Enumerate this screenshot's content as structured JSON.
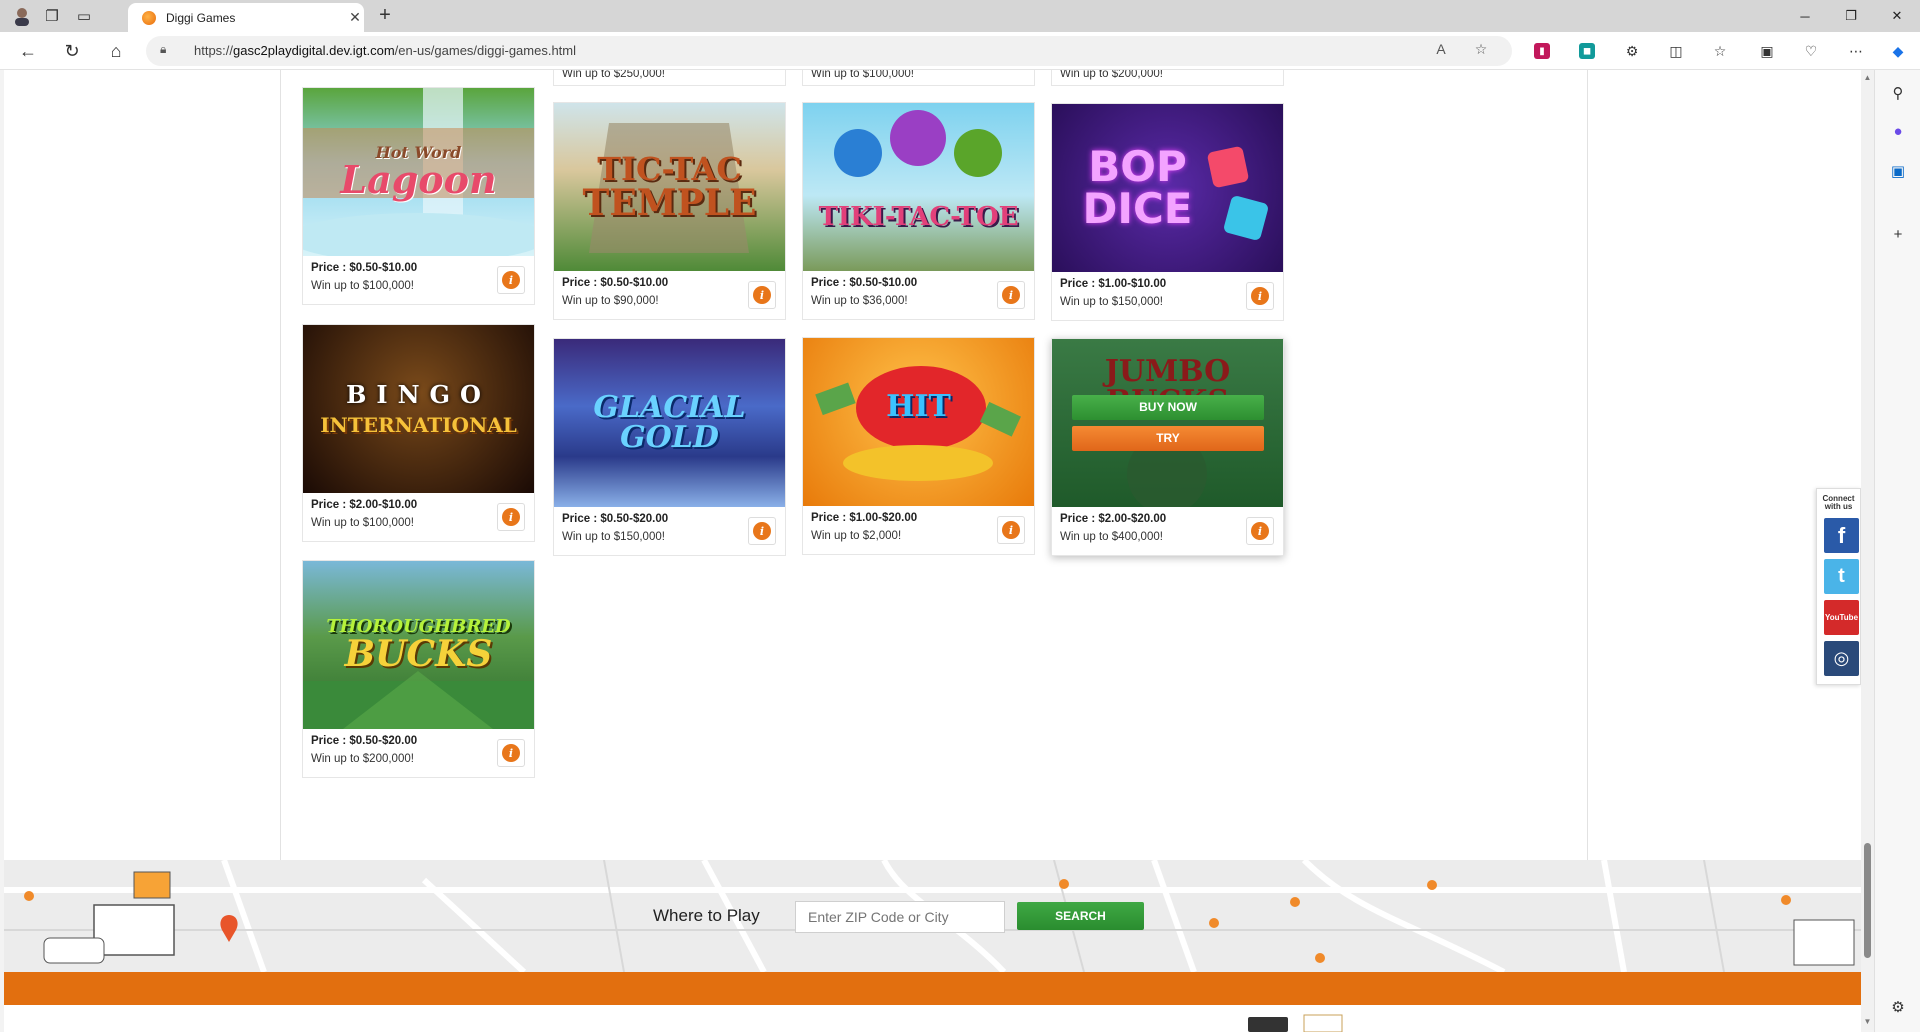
{
  "browser": {
    "tab_title": "Diggi Games",
    "url_prefix": "https://",
    "url_host": "gasc2playdigital.dev.igt.com",
    "url_path": "/en-us/games/diggi-games.html"
  },
  "top_partial_row": [
    {
      "win": "Win up to $250,000!"
    },
    {
      "win": "Win up to $100,000!"
    },
    {
      "win": "Win up to $200,000!"
    }
  ],
  "games": [
    {
      "name": "Hot Word Lagoon",
      "art_line1": "Hot Word",
      "art_line2": "Lagoon",
      "price": "Price : $0.50-$10.00",
      "win": "Win up to $100,000!"
    },
    {
      "name": "Tic-Tac Temple",
      "art_line1": "TIC-TAC",
      "art_line2": "TEMPLE",
      "price": "Price : $0.50-$10.00",
      "win": "Win up to $90,000!"
    },
    {
      "name": "Tiki-Tac-Toe",
      "art_line1": "",
      "art_line2": "TIKI-TAC-TOE",
      "price": "Price : $0.50-$10.00",
      "win": "Win up to $36,000!"
    },
    {
      "name": "Bop Dice",
      "art_line1": "BOP",
      "art_line2": "DICE",
      "price": "Price : $1.00-$10.00",
      "win": "Win up to $150,000!"
    },
    {
      "name": "Bingo International",
      "art_line1": "BINGO",
      "art_line2": "INTERNATIONAL",
      "price": "Price : $2.00-$10.00",
      "win": "Win up to $100,000!"
    },
    {
      "name": "Glacial Gold",
      "art_line1": "",
      "art_line2": "GLACIAL GOLD",
      "price": "Price : $0.50-$20.00",
      "win": "Win up to $150,000!"
    },
    {
      "name": "Hit",
      "art_line1": "",
      "art_line2": "HIT",
      "price": "Price : $1.00-$20.00",
      "win": "Win up to $2,000!"
    },
    {
      "name": "Jumbo Bucks",
      "art_line1": "",
      "art_line2": "JUMBO BUCKS",
      "price": "Price : $2.00-$20.00",
      "win": "Win up to $400,000!",
      "buy_label": "BUY NOW",
      "try_label": "TRY"
    },
    {
      "name": "Thoroughbred Bucks",
      "art_line1": "THOROUGHBRED",
      "art_line2": "BUCKS",
      "price": "Price : $0.50-$20.00",
      "win": "Win up to $200,000!"
    }
  ],
  "social": {
    "label": "Connect with us",
    "facebook": "f",
    "twitter": "t",
    "youtube": "YouTube",
    "instagram": "◎"
  },
  "footer": {
    "where_to_play": "Where to Play",
    "zip_placeholder": "Enter ZIP Code or City",
    "search_label": "SEARCH"
  },
  "colors": {
    "accent_orange": "#e26f0f",
    "button_green": "#2d8f31",
    "info_orange": "#e8761a"
  }
}
